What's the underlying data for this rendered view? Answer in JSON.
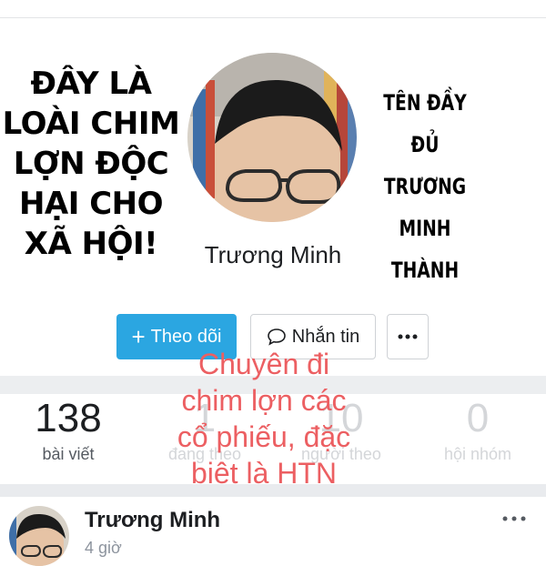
{
  "overlay": {
    "left_lines": [
      "ĐÂY LÀ",
      "LOÀI CHIM",
      "LỢN ĐỘC",
      "HẠI CHO",
      "XÃ HỘI!"
    ],
    "right_lines": [
      "TÊN ĐẦY",
      "ĐỦ",
      "TRƯƠNG",
      "MINH",
      "THÀNH"
    ],
    "center_lines": [
      "Chuyên đi",
      "chim lợn các",
      "cổ phiếu, đặc",
      "biệt là HTN"
    ],
    "center_color": "#ec5f62"
  },
  "profile": {
    "name": "Trương Minh",
    "follow_label": "Theo dõi",
    "message_label": "Nhắn tin",
    "accent": "#2ba6e1"
  },
  "stats": [
    {
      "value": "138",
      "label": "bài viết"
    },
    {
      "value": "1",
      "label": "đang theo"
    },
    {
      "value": "10",
      "label": "người theo"
    },
    {
      "value": "0",
      "label": "hội nhóm"
    }
  ],
  "post": {
    "author": "Trương Minh",
    "time": "4 giờ"
  },
  "icons": {
    "follow": "plus-icon",
    "message": "chat-bubble-icon",
    "more": "more-dots-icon"
  }
}
